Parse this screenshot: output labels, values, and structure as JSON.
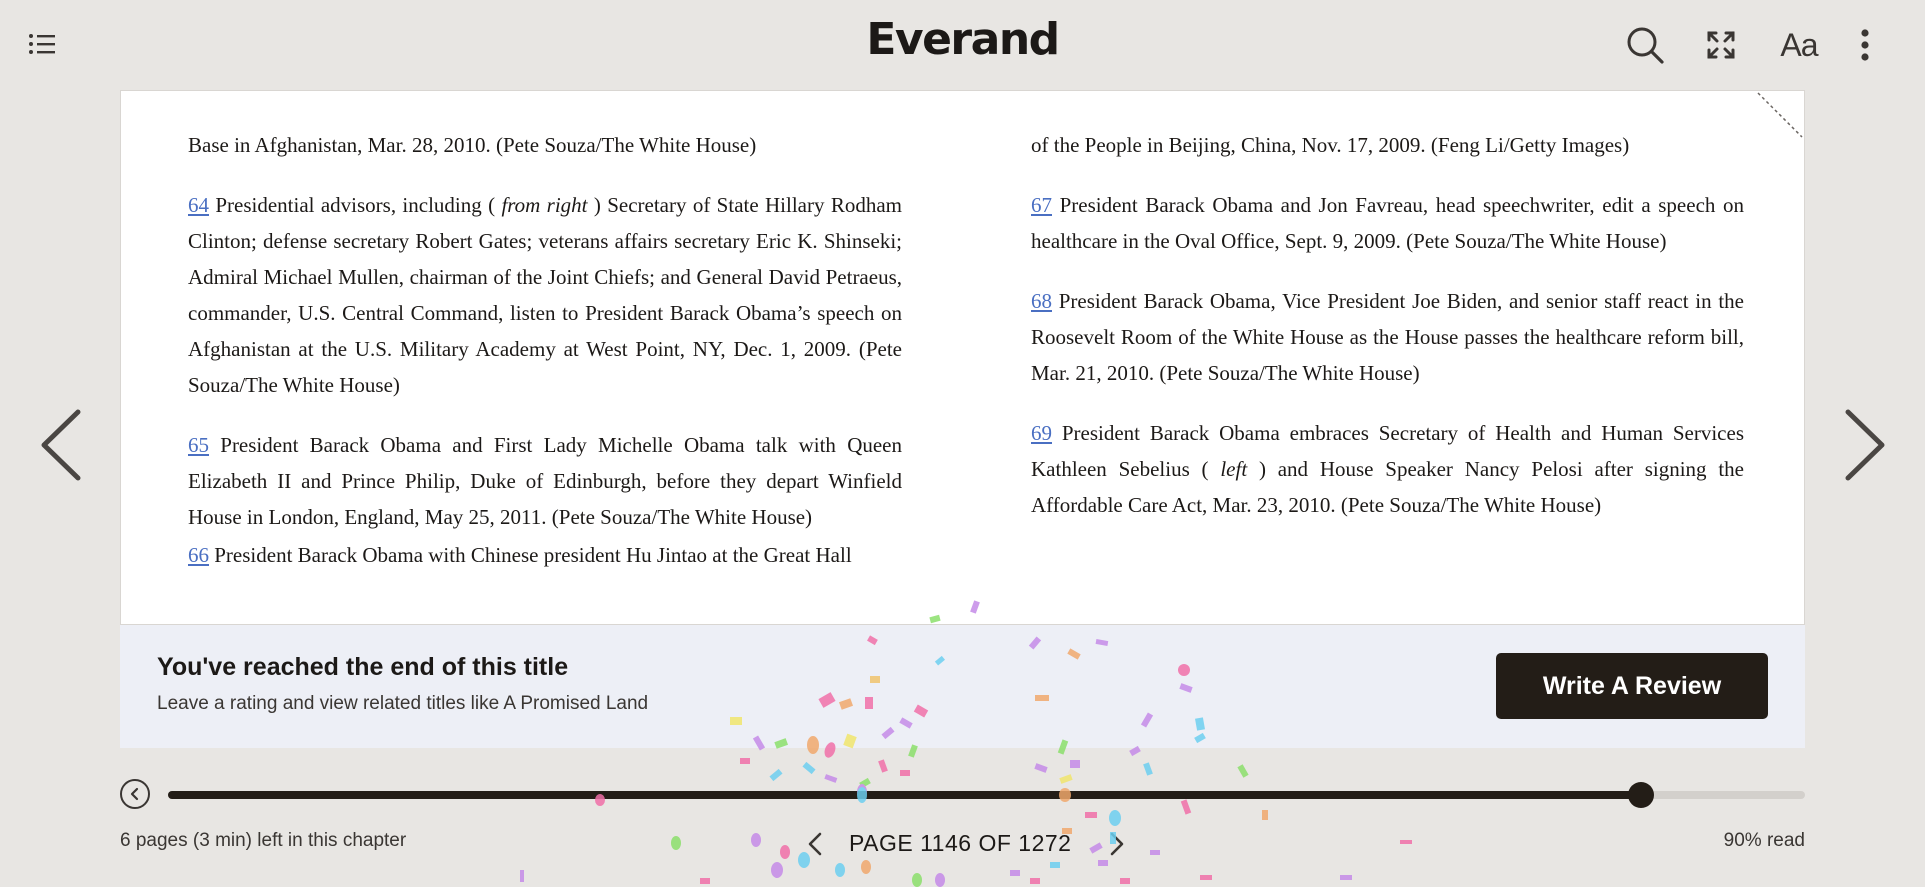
{
  "app": {
    "logo": "Everand"
  },
  "toolbar": {
    "toc_icon": "list-icon",
    "search_icon": "search-icon",
    "fullscreen_icon": "expand-icon",
    "font_settings_label": "Aa",
    "more_icon": "more-vertical-icon"
  },
  "book": {
    "left_column": {
      "p0": "Base in Afghanistan, Mar. 28, 2010. (Pete Souza/The White House)",
      "p1_num": "64",
      "p1_a": " Presidential advisors, including ( ",
      "p1_i": "from right",
      "p1_b": " ) Secretary of State Hillary Rodham Clinton; defense secretary Robert Gates; veterans affairs secretary Eric K. Shinseki; Admiral Michael Mullen, chairman of the Joint Chiefs; and General David Petraeus, commander, U.S. Central Command, listen to President Barack Obama’s speech on Afghanistan at the U.S. Military Academy at West Point, NY, Dec. 1, 2009. (Pete Souza/The White House)",
      "p2_num": "65",
      "p2_text": " President Barack Obama and First Lady Michelle Obama talk with Queen Elizabeth II and Prince Philip, Duke of Edinburgh, before they depart Winfield House in London, England, May 25, 2011. (Pete Souza/The White House)",
      "p3_num": "66",
      "p3_text": " President Barack Obama with Chinese president Hu Jintao at the Great Hall"
    },
    "right_column": {
      "p0": "of the People in Beijing, China, Nov. 17, 2009. (Feng Li/Getty Images)",
      "p1_num": "67",
      "p1_text": " President Barack Obama and Jon Favreau, head speechwriter, edit a speech on healthcare in the Oval Office, Sept. 9, 2009. (Pete Souza/The White House)",
      "p2_num": "68",
      "p2_text": " President Barack Obama, Vice President Joe Biden, and senior staff react in the Roosevelt Room of the White House as the House passes the healthcare reform bill, Mar. 21, 2010. (Pete Souza/The White House)",
      "p3_num": "69",
      "p3_a": " President Barack Obama embraces Secretary of Health and Human Services Kathleen Sebelius ( ",
      "p3_i": "left",
      "p3_b": " ) and House Speaker Nancy Pelosi after signing the Affordable Care Act, Mar. 23, 2010. (Pete Souza/The White House)"
    }
  },
  "end_banner": {
    "title": "You've reached the end of this title",
    "subtitle": "Leave a rating and view related titles like A Promised Land",
    "button_label": "Write A Review"
  },
  "progress": {
    "fraction": 0.9,
    "chapter_left": "6 pages (3 min) left in this chapter",
    "page_label": "PAGE 1146 OF 1272",
    "percent_read": "90% read"
  },
  "colors": {
    "background": "#e8e6e3",
    "accent_dark": "#231d17",
    "link_blue": "#4a6fc2",
    "banner_bg": "#edeff6"
  }
}
